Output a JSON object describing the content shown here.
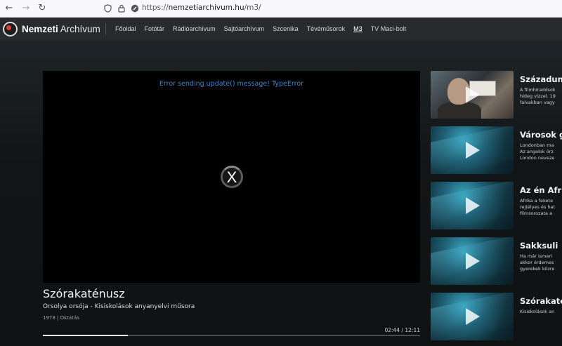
{
  "browser": {
    "url_prefix": "https://",
    "url_host": "nemzetiarchivum.hu",
    "url_path": "/m3/"
  },
  "site": {
    "logo_bold": "Nemzeti",
    "logo_light": "Archívum",
    "nav": [
      "Főoldal",
      "Fotótár",
      "Rádióarchívum",
      "Sajtóarchívum",
      "Szcenika",
      "Tévéműsorok",
      "M3",
      "TV Maci-bolt"
    ],
    "active_nav": "M3"
  },
  "player": {
    "error": "Error sending update() message! TypeError",
    "spinner_glyph": "X",
    "title": "Szórakaténusz",
    "subtitle": "Orsolya orsója - Kisiskolások anyanyelvi műsora",
    "meta": "1978 | Oktatás",
    "time": "02:44 / 12:11",
    "progress_fraction": 0.225
  },
  "sidebar": [
    {
      "title": "Századunk",
      "desc": [
        "A filmhíradósok",
        "hideg vízzel. 19",
        "falvakban vagy"
      ],
      "thumb": "photo"
    },
    {
      "title": "Városok g",
      "desc": [
        "Londonban ma",
        "Az angolok örz",
        "London neveze"
      ],
      "thumb": "placeholder"
    },
    {
      "title": "Az én Afrik",
      "desc": [
        "Afrika a fekete",
        "rejtélyes és hat",
        "filmsorozata a"
      ],
      "thumb": "placeholder"
    },
    {
      "title": "Sakksuli",
      "desc": [
        "Ha már ismeri",
        "akkor érdemes",
        "gyerekek közre"
      ],
      "thumb": "placeholder"
    },
    {
      "title": "Szórakaté",
      "desc": [
        "Kisiskolások an"
      ],
      "thumb": "placeholder"
    }
  ],
  "colors": {
    "accent_red": "#e43a3a",
    "error_blue": "#3d86c8",
    "header_bg": "#272b2e"
  }
}
